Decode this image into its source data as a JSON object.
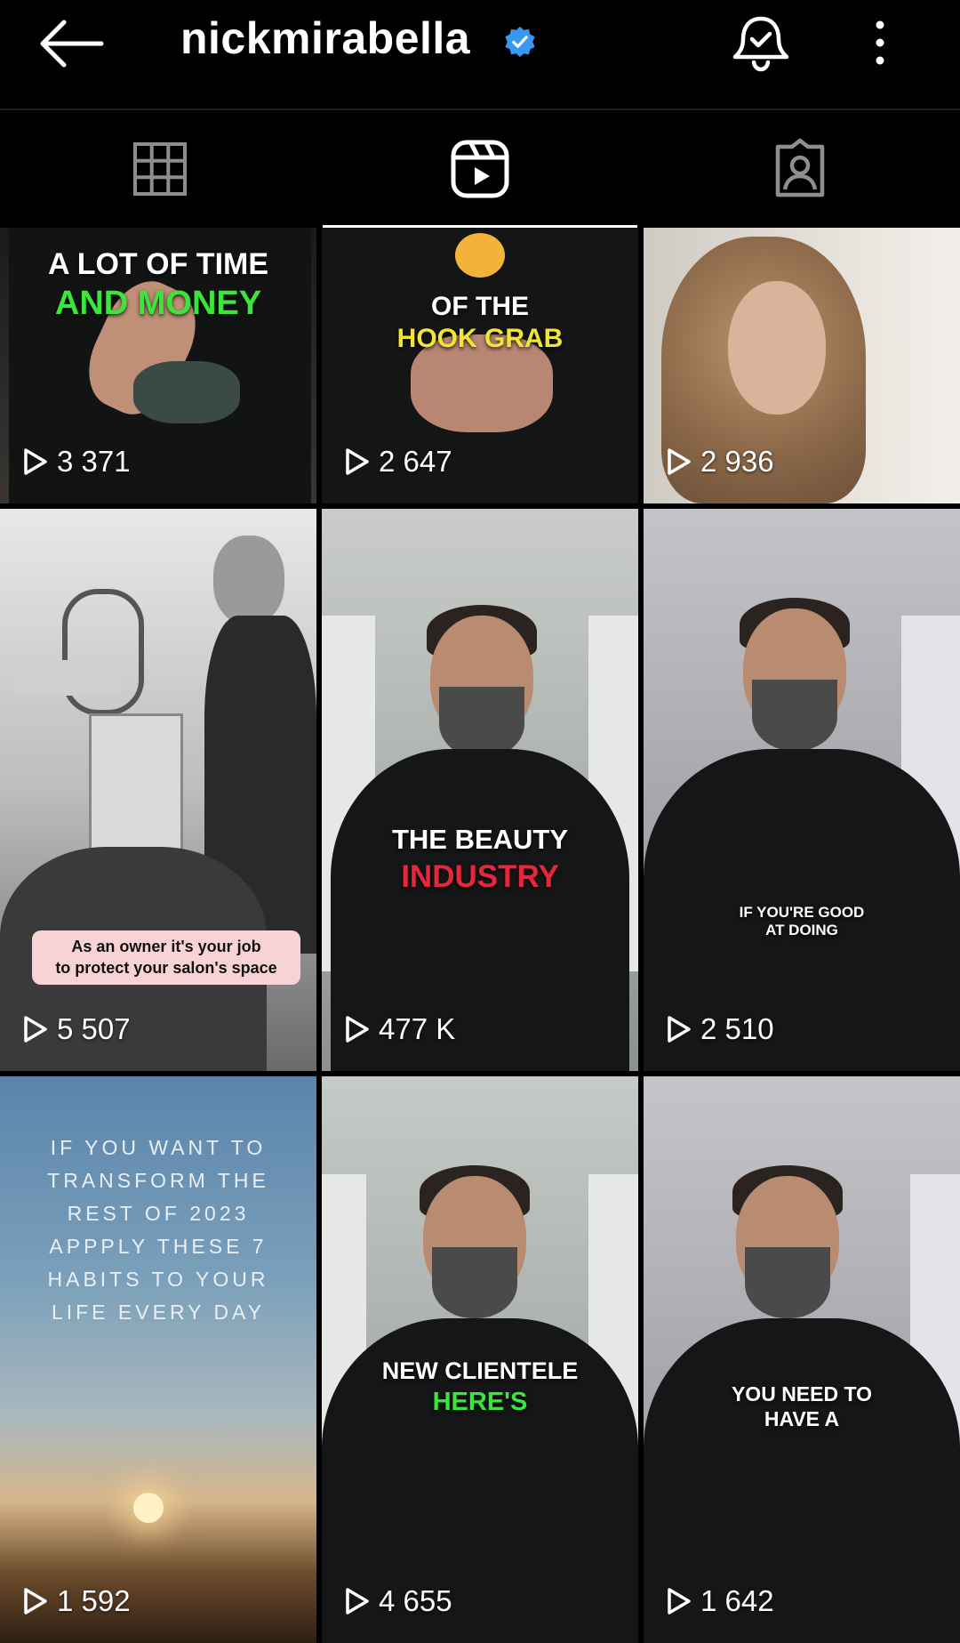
{
  "header": {
    "title": "nickmirabella",
    "back_icon": "arrow-left-icon",
    "verified_icon": "verified-badge-icon",
    "notify_icon": "bell-check-icon",
    "more_icon": "more-vertical-icon"
  },
  "tabs": [
    {
      "name": "posts",
      "icon": "grid-icon"
    },
    {
      "name": "reels",
      "icon": "reels-icon",
      "active": true
    },
    {
      "name": "tagged",
      "icon": "tagged-person-icon"
    }
  ],
  "reels": [
    {
      "views": "3 371",
      "overlay": [
        "A LOT OF TIME",
        "AND MONEY"
      ]
    },
    {
      "views": "2 647",
      "overlay": [
        "OF THE",
        "HOOK GRAB"
      ]
    },
    {
      "views": "2 936"
    },
    {
      "views": "5 507",
      "caption": [
        "As an owner it's your job",
        "to protect your salon's space"
      ]
    },
    {
      "views": "477 K",
      "overlay": [
        "THE BEAUTY",
        "INDUSTRY"
      ]
    },
    {
      "views": "2 510",
      "overlay": [
        "IF YOU'RE GOOD",
        "AT DOING"
      ]
    },
    {
      "views": "1 592",
      "quote": [
        "IF YOU WANT TO",
        "TRANSFORM THE",
        "REST OF 2023",
        "APPPLY THESE 7",
        "HABITS TO YOUR",
        "LIFE EVERY DAY"
      ]
    },
    {
      "views": "4 655",
      "overlay": [
        "NEW CLIENTELE",
        "HERE'S"
      ]
    },
    {
      "views": "1 642",
      "overlay": [
        "YOU NEED TO",
        "HAVE A"
      ]
    }
  ]
}
